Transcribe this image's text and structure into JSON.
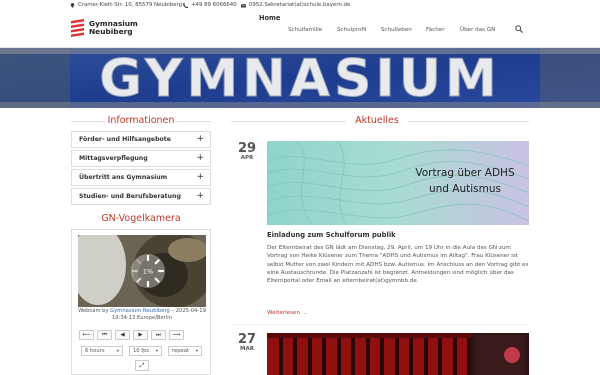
{
  "topbar": {
    "address": "Cramer-Klett-Str. 10, 85579 Neubiberg",
    "phone": "+49 89 6066640",
    "email": "0952.Sekretariat(at)schule.bayern.de"
  },
  "header": {
    "logo_line1": "Gymnasium",
    "logo_line2": "Neubiberg",
    "home_label": "Home",
    "nav": [
      "Schulfamilie",
      "Schulprofil",
      "Schulleben",
      "Fächer",
      "Über das GN"
    ],
    "banner_text": "GYMNASIUM"
  },
  "sidebar": {
    "info_title": "Informationen",
    "accordion": [
      "Förder- und Hilfsangebote",
      "Mittagsverpflegung",
      "Übertritt ans Gymnasium",
      "Studien- und Berufsberatung"
    ],
    "cam_title": "GN-Vogelkamera",
    "cam_loading": "1%",
    "cam_caption_prefix": "Webcam by",
    "cam_caption_link": "Gymnasium Neubiberg",
    "cam_caption_suffix": "– 2025-04-19 19:34:13 Europe/Berlin",
    "controls": [
      "⟵",
      "⏮",
      "◀",
      "▶",
      "⏭",
      "⟶"
    ],
    "select_range": "6 hours",
    "select_fps": "10 fps",
    "select_mode": "repeat",
    "expand_icon": "⤢"
  },
  "news": {
    "section_title": "Aktuelles",
    "items": [
      {
        "day": "29",
        "month": "APR",
        "image_text_line1": "Vortrag über ADHS",
        "image_text_line2": "und Autismus",
        "title": "Einladung zum Schulforum publik",
        "body": "Der Elternbeirat des GN lädt am Dienstag, 29. April, um 19 Uhr in die Aula des GN zum Vortrag von Heike Klüsener zum Thema \"ADHS und Autismus im Alltag\". Frau Klüsener ist selbst Mutter von zwei Kindern mit ADHS bzw. Autismus. Im Anschluss an den Vortrag gibt es eine Austauschrunde. Die Platzanzahl ist begrenzt. Anmeldungen sind möglich über das Elternportal oder Email an elternbeirat(at)gymnbb.de.",
        "more": "Weiterlesen ..."
      },
      {
        "day": "27",
        "month": "MAR"
      }
    ]
  },
  "colors": {
    "accent": "#c0392b",
    "link": "#2f6fb3"
  }
}
